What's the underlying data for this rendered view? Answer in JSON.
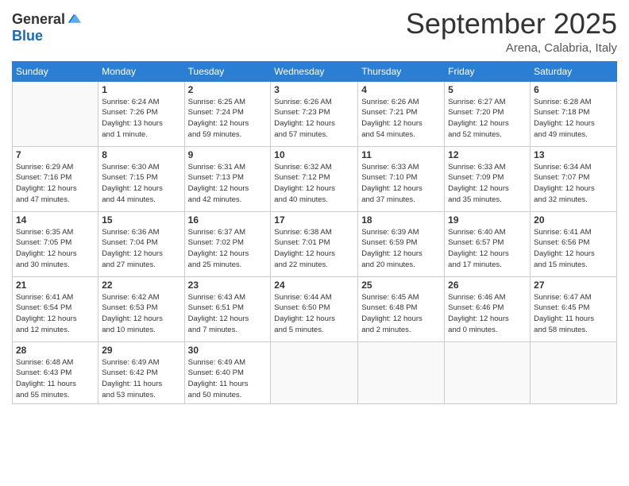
{
  "header": {
    "logo_general": "General",
    "logo_blue": "Blue",
    "month": "September 2025",
    "location": "Arena, Calabria, Italy"
  },
  "weekdays": [
    "Sunday",
    "Monday",
    "Tuesday",
    "Wednesday",
    "Thursday",
    "Friday",
    "Saturday"
  ],
  "weeks": [
    [
      {
        "day": "",
        "info": ""
      },
      {
        "day": "1",
        "info": "Sunrise: 6:24 AM\nSunset: 7:26 PM\nDaylight: 13 hours\nand 1 minute."
      },
      {
        "day": "2",
        "info": "Sunrise: 6:25 AM\nSunset: 7:24 PM\nDaylight: 12 hours\nand 59 minutes."
      },
      {
        "day": "3",
        "info": "Sunrise: 6:26 AM\nSunset: 7:23 PM\nDaylight: 12 hours\nand 57 minutes."
      },
      {
        "day": "4",
        "info": "Sunrise: 6:26 AM\nSunset: 7:21 PM\nDaylight: 12 hours\nand 54 minutes."
      },
      {
        "day": "5",
        "info": "Sunrise: 6:27 AM\nSunset: 7:20 PM\nDaylight: 12 hours\nand 52 minutes."
      },
      {
        "day": "6",
        "info": "Sunrise: 6:28 AM\nSunset: 7:18 PM\nDaylight: 12 hours\nand 49 minutes."
      }
    ],
    [
      {
        "day": "7",
        "info": "Sunrise: 6:29 AM\nSunset: 7:16 PM\nDaylight: 12 hours\nand 47 minutes."
      },
      {
        "day": "8",
        "info": "Sunrise: 6:30 AM\nSunset: 7:15 PM\nDaylight: 12 hours\nand 44 minutes."
      },
      {
        "day": "9",
        "info": "Sunrise: 6:31 AM\nSunset: 7:13 PM\nDaylight: 12 hours\nand 42 minutes."
      },
      {
        "day": "10",
        "info": "Sunrise: 6:32 AM\nSunset: 7:12 PM\nDaylight: 12 hours\nand 40 minutes."
      },
      {
        "day": "11",
        "info": "Sunrise: 6:33 AM\nSunset: 7:10 PM\nDaylight: 12 hours\nand 37 minutes."
      },
      {
        "day": "12",
        "info": "Sunrise: 6:33 AM\nSunset: 7:09 PM\nDaylight: 12 hours\nand 35 minutes."
      },
      {
        "day": "13",
        "info": "Sunrise: 6:34 AM\nSunset: 7:07 PM\nDaylight: 12 hours\nand 32 minutes."
      }
    ],
    [
      {
        "day": "14",
        "info": "Sunrise: 6:35 AM\nSunset: 7:05 PM\nDaylight: 12 hours\nand 30 minutes."
      },
      {
        "day": "15",
        "info": "Sunrise: 6:36 AM\nSunset: 7:04 PM\nDaylight: 12 hours\nand 27 minutes."
      },
      {
        "day": "16",
        "info": "Sunrise: 6:37 AM\nSunset: 7:02 PM\nDaylight: 12 hours\nand 25 minutes."
      },
      {
        "day": "17",
        "info": "Sunrise: 6:38 AM\nSunset: 7:01 PM\nDaylight: 12 hours\nand 22 minutes."
      },
      {
        "day": "18",
        "info": "Sunrise: 6:39 AM\nSunset: 6:59 PM\nDaylight: 12 hours\nand 20 minutes."
      },
      {
        "day": "19",
        "info": "Sunrise: 6:40 AM\nSunset: 6:57 PM\nDaylight: 12 hours\nand 17 minutes."
      },
      {
        "day": "20",
        "info": "Sunrise: 6:41 AM\nSunset: 6:56 PM\nDaylight: 12 hours\nand 15 minutes."
      }
    ],
    [
      {
        "day": "21",
        "info": "Sunrise: 6:41 AM\nSunset: 6:54 PM\nDaylight: 12 hours\nand 12 minutes."
      },
      {
        "day": "22",
        "info": "Sunrise: 6:42 AM\nSunset: 6:53 PM\nDaylight: 12 hours\nand 10 minutes."
      },
      {
        "day": "23",
        "info": "Sunrise: 6:43 AM\nSunset: 6:51 PM\nDaylight: 12 hours\nand 7 minutes."
      },
      {
        "day": "24",
        "info": "Sunrise: 6:44 AM\nSunset: 6:50 PM\nDaylight: 12 hours\nand 5 minutes."
      },
      {
        "day": "25",
        "info": "Sunrise: 6:45 AM\nSunset: 6:48 PM\nDaylight: 12 hours\nand 2 minutes."
      },
      {
        "day": "26",
        "info": "Sunrise: 6:46 AM\nSunset: 6:46 PM\nDaylight: 12 hours\nand 0 minutes."
      },
      {
        "day": "27",
        "info": "Sunrise: 6:47 AM\nSunset: 6:45 PM\nDaylight: 11 hours\nand 58 minutes."
      }
    ],
    [
      {
        "day": "28",
        "info": "Sunrise: 6:48 AM\nSunset: 6:43 PM\nDaylight: 11 hours\nand 55 minutes."
      },
      {
        "day": "29",
        "info": "Sunrise: 6:49 AM\nSunset: 6:42 PM\nDaylight: 11 hours\nand 53 minutes."
      },
      {
        "day": "30",
        "info": "Sunrise: 6:49 AM\nSunset: 6:40 PM\nDaylight: 11 hours\nand 50 minutes."
      },
      {
        "day": "",
        "info": ""
      },
      {
        "day": "",
        "info": ""
      },
      {
        "day": "",
        "info": ""
      },
      {
        "day": "",
        "info": ""
      }
    ]
  ]
}
